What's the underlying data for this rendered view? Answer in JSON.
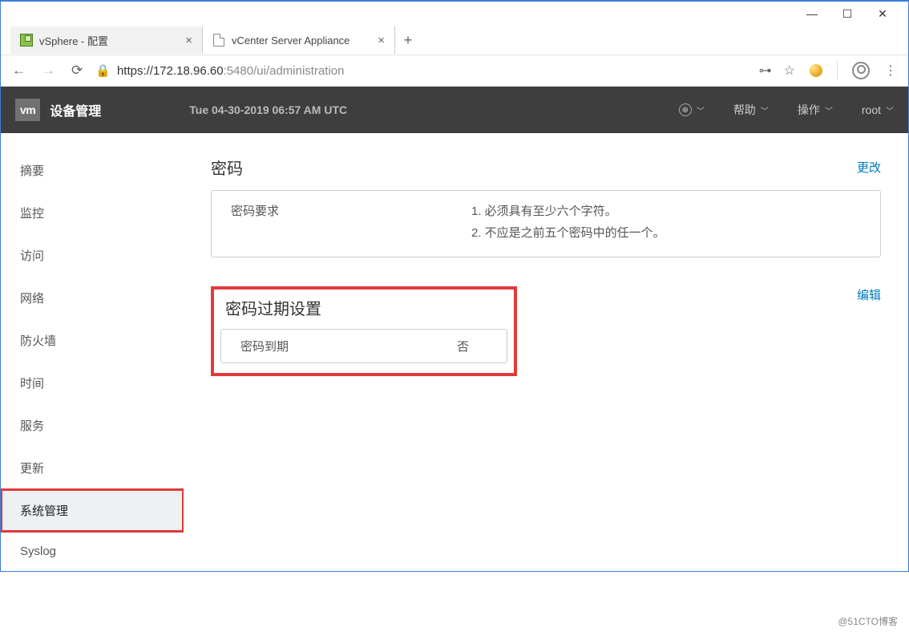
{
  "browser": {
    "tabs": [
      {
        "title": "vSphere - 配置",
        "active": false
      },
      {
        "title": "vCenter Server Appliance",
        "active": true
      }
    ],
    "url": {
      "proto": "https://",
      "host": "172.18.96.60",
      "port": ":5480",
      "path": "/ui/administration"
    }
  },
  "header": {
    "logo": "vm",
    "title": "设备管理",
    "time": "Tue 04-30-2019 06:57 AM UTC",
    "help": "帮助",
    "actions": "操作",
    "user": "root"
  },
  "sidebar": {
    "items": [
      {
        "label": "摘要"
      },
      {
        "label": "监控"
      },
      {
        "label": "访问"
      },
      {
        "label": "网络"
      },
      {
        "label": "防火墙"
      },
      {
        "label": "时间"
      },
      {
        "label": "服务"
      },
      {
        "label": "更新"
      },
      {
        "label": "系统管理",
        "active": true
      },
      {
        "label": "Syslog"
      }
    ]
  },
  "content": {
    "password": {
      "title": "密码",
      "action": "更改",
      "req_label": "密码要求",
      "req1": "1. 必须具有至少六个字符。",
      "req2": "2. 不应是之前五个密码中的任一个。"
    },
    "expiry": {
      "title": "密码过期设置",
      "action": "编辑",
      "label": "密码到期",
      "value": "否"
    }
  },
  "watermark": "@51CTO博客"
}
